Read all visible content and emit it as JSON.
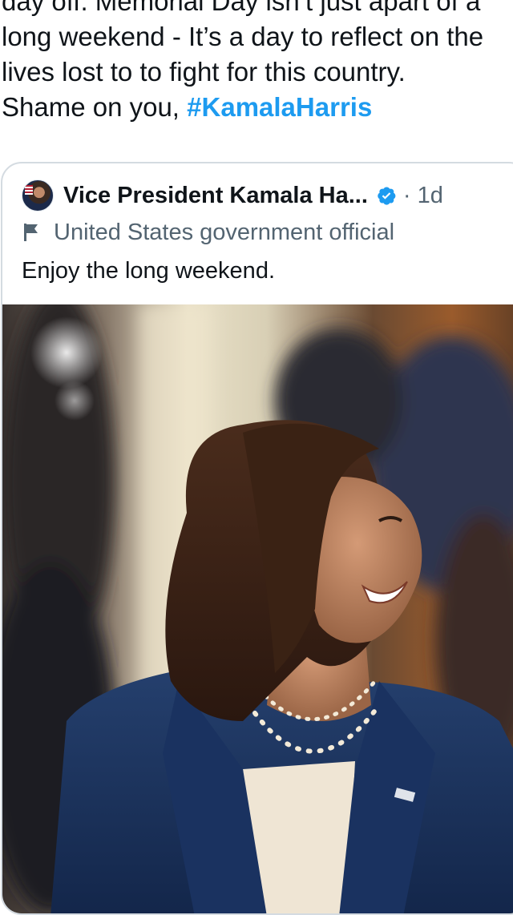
{
  "tweet": {
    "text_lines": [
      "day off. Memorial Day isn’t just apart of a",
      "long weekend - It’s a day to reflect on the",
      "lives lost to to fight for this country.",
      "Shame on you, "
    ],
    "hashtag": "#KamalaHarris"
  },
  "quoted_tweet": {
    "author_name": "Vice President Kamala Ha...",
    "verified_icon": "verified-badge-icon",
    "time": "· 1d",
    "label_icon": "flag-icon",
    "label": "United States government official",
    "body": "Enjoy the long weekend.",
    "image": "photo of Kamala Harris smiling in a navy blazer with pearl necklace"
  },
  "colors": {
    "hashtag": "#1d9bf0",
    "verified": "#1d9bf0",
    "secondary_text": "#536471",
    "card_border": "#d4dbe1"
  }
}
